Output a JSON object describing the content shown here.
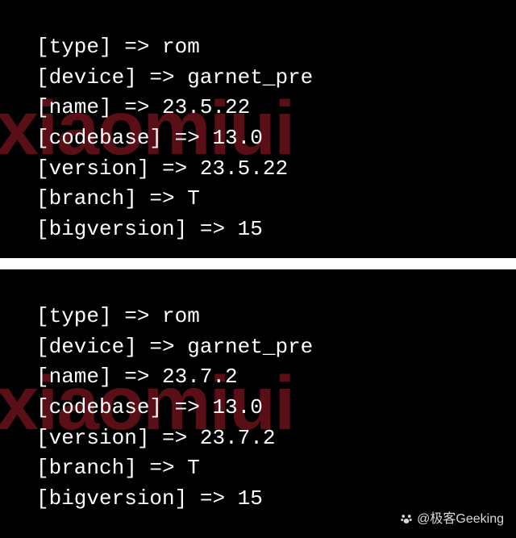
{
  "watermark": "xiaomiui",
  "attribution": "@极客Geeking",
  "panels": [
    {
      "entries": [
        {
          "key": "[type]",
          "value": "rom"
        },
        {
          "key": "[device]",
          "value": "garnet_pre"
        },
        {
          "key": "[name]",
          "value": "23.5.22"
        },
        {
          "key": "[codebase]",
          "value": "13.0"
        },
        {
          "key": "[version]",
          "value": "23.5.22"
        },
        {
          "key": "[branch]",
          "value": "T"
        },
        {
          "key": "[bigversion]",
          "value": "15"
        }
      ]
    },
    {
      "entries": [
        {
          "key": "[type]",
          "value": "rom"
        },
        {
          "key": "[device]",
          "value": "garnet_pre"
        },
        {
          "key": "[name]",
          "value": "23.7.2"
        },
        {
          "key": "[codebase]",
          "value": "13.0"
        },
        {
          "key": "[version]",
          "value": "23.7.2"
        },
        {
          "key": "[branch]",
          "value": "T"
        },
        {
          "key": "[bigversion]",
          "value": "15"
        }
      ]
    }
  ],
  "arrow": " => "
}
